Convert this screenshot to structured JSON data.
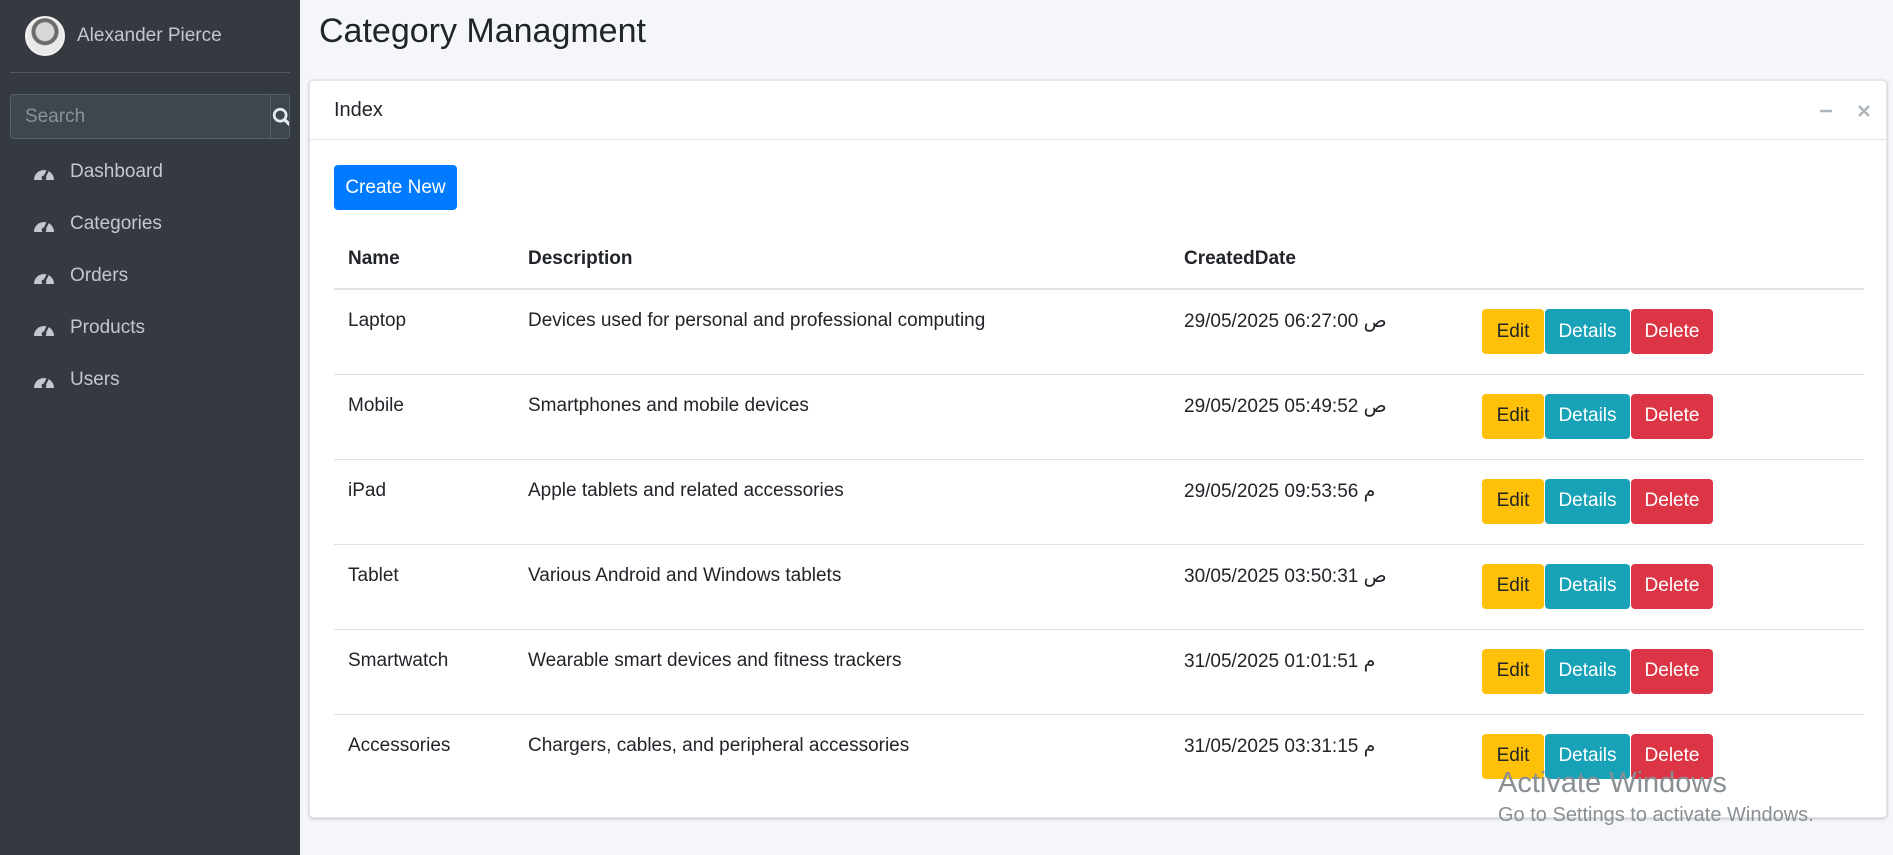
{
  "sidebar": {
    "user_name": "Alexander Pierce",
    "search_placeholder": "Search",
    "items": [
      {
        "label": "Dashboard",
        "icon": "tachometer-icon"
      },
      {
        "label": "Categories",
        "icon": "tachometer-icon"
      },
      {
        "label": "Orders",
        "icon": "tachometer-icon"
      },
      {
        "label": "Products",
        "icon": "tachometer-icon"
      },
      {
        "label": "Users",
        "icon": "tachometer-icon"
      }
    ]
  },
  "header": {
    "title": "Category Managment"
  },
  "card": {
    "title": "Index",
    "create_label": "Create New",
    "tools": [
      "minimize-icon",
      "close-icon"
    ]
  },
  "table": {
    "columns": [
      "Name",
      "Description",
      "CreatedDate",
      ""
    ],
    "rows": [
      {
        "name": "Laptop",
        "description": "Devices used for personal and professional computing",
        "created": "29/05/2025 06:27:00 ص"
      },
      {
        "name": "Mobile",
        "description": "Smartphones and mobile devices",
        "created": "29/05/2025 05:49:52 ص"
      },
      {
        "name": "iPad",
        "description": "Apple tablets and related accessories",
        "created": "29/05/2025 09:53:56 م"
      },
      {
        "name": "Tablet",
        "description": "Various Android and Windows tablets",
        "created": "30/05/2025 03:50:31 ص"
      },
      {
        "name": "Smartwatch",
        "description": "Wearable smart devices and fitness trackers",
        "created": "31/05/2025 01:01:51 م"
      },
      {
        "name": "Accessories",
        "description": "Chargers, cables, and peripheral accessories",
        "created": "31/05/2025 03:31:15 م"
      }
    ],
    "actions": {
      "edit": "Edit",
      "details": "Details",
      "delete": "Delete"
    }
  },
  "watermark": {
    "line1": "Activate Windows",
    "line2": "Go to Settings to activate Windows."
  },
  "colors": {
    "sidebar_bg": "#343a40",
    "primary": "#007bff",
    "warning": "#ffc107",
    "info": "#17a2b8",
    "danger": "#dc3545"
  }
}
